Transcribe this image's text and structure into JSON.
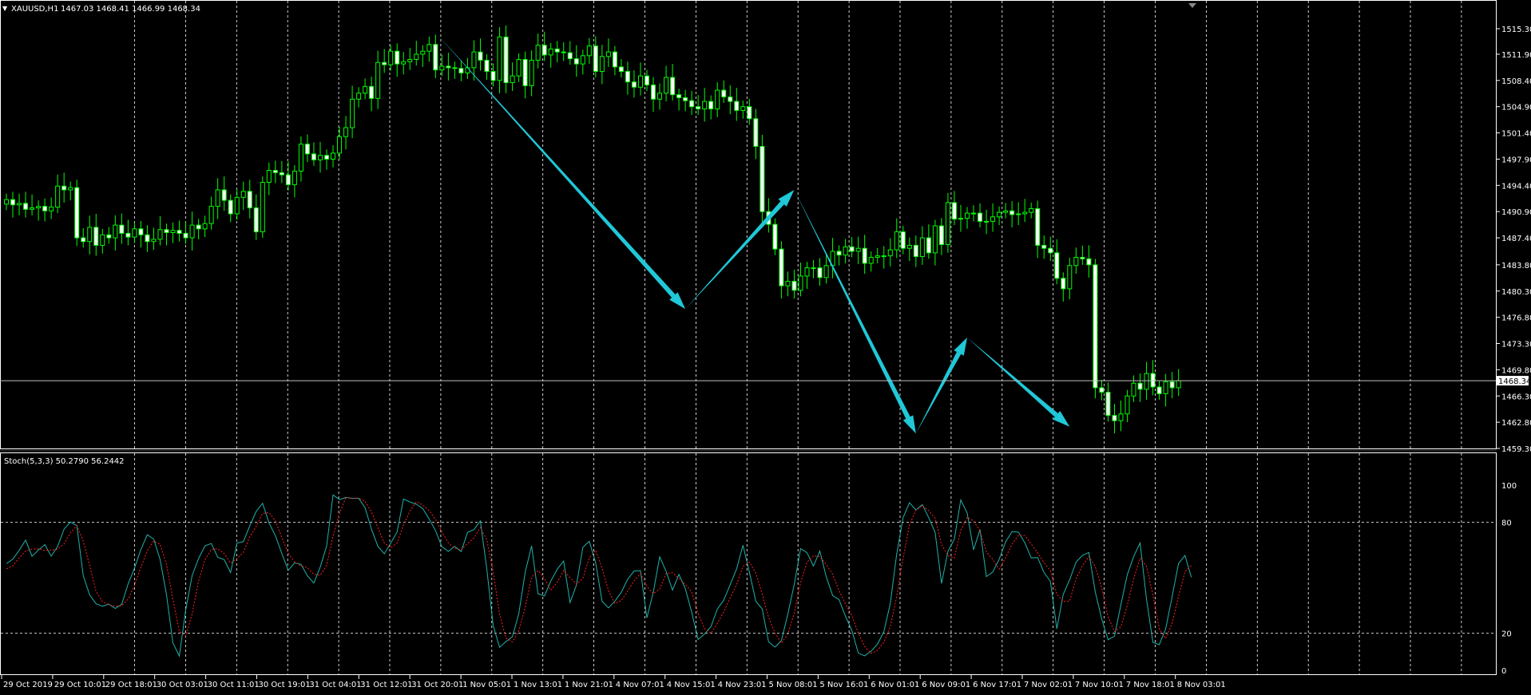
{
  "header": {
    "symbol": "XAUUSD,H1",
    "ohlc": "1467.03 1468.41 1466.99 1468.34",
    "stoch_label": "Stoch(5,3,3) 50.2790 56.2442"
  },
  "colors": {
    "background": "#000000",
    "candle_up_fill": "#000000",
    "candle_down_fill": "#FFFFFF",
    "candle_wick": "#00FF00",
    "grid": "#FFFFFF",
    "price_line": "#C0C0C0",
    "stoch_main": "#20B2AA",
    "stoch_signal": "#FF2020",
    "arrow": "#20C8D8"
  },
  "chart_data": [
    {
      "type": "candlestick",
      "title": "XAUUSD,H1",
      "current_price": 1468.34,
      "y_ticks": [
        1515.3,
        1511.9,
        1508.4,
        1504.9,
        1501.4,
        1497.9,
        1494.4,
        1490.9,
        1487.4,
        1483.8,
        1480.3,
        1476.8,
        1473.3,
        1469.8,
        1466.3,
        1462.8,
        1459.3
      ],
      "y_tick_labels": [
        "1515.30",
        "1511.90",
        "1508.40",
        "1504.90",
        "1501.40",
        "1497.90",
        "1494.40",
        "1490.90",
        "1487.40",
        "1483.80",
        "1480.30",
        "1476.80",
        "1473.30",
        "1469.80",
        "1466.30",
        "1462.80",
        "1459.30"
      ],
      "current_price_label": "1468.34",
      "ylim": [
        1459.3,
        1515.3
      ],
      "x_labels": [
        "29 Oct 2019",
        "29 Oct 10:01",
        "29 Oct 18:01",
        "30 Oct 03:01",
        "30 Oct 11:01",
        "30 Oct 19:01",
        "31 Oct 04:01",
        "31 Oct 12:01",
        "31 Oct 20:01",
        "1 Nov 05:01",
        "1 Nov 13:01",
        "1 Nov 21:01",
        "4 Nov 07:01",
        "4 Nov 15:01",
        "4 Nov 23:01",
        "5 Nov 08:01",
        "5 Nov 16:01",
        "6 Nov 01:01",
        "6 Nov 09:01",
        "6 Nov 17:01",
        "7 Nov 02:01",
        "7 Nov 10:01",
        "7 Nov 18:01",
        "8 Nov 03:01"
      ],
      "closes": [
        1492.5,
        1491.8,
        1492.0,
        1491.2,
        1491.4,
        1491.6,
        1491.0,
        1491.5,
        1494.3,
        1493.8,
        1494.1,
        1487.4,
        1486.9,
        1488.8,
        1486.4,
        1487.8,
        1487.4,
        1489.1,
        1488.0,
        1487.5,
        1488.6,
        1487.8,
        1486.9,
        1487.2,
        1488.5,
        1488.1,
        1488.4,
        1488.0,
        1487.4,
        1489.1,
        1488.6,
        1489.3,
        1491.6,
        1493.8,
        1492.4,
        1490.6,
        1492.8,
        1493.6,
        1491.4,
        1488.2,
        1494.8,
        1496.4,
        1496.1,
        1495.8,
        1494.5,
        1496.3,
        1499.9,
        1498.6,
        1497.8,
        1498.4,
        1497.9,
        1498.7,
        1500.9,
        1502.1,
        1505.9,
        1506.7,
        1507.6,
        1506.0,
        1510.8,
        1510.5,
        1512.3,
        1510.6,
        1510.9,
        1511.2,
        1511.9,
        1512.3,
        1513.2,
        1509.8,
        1510.3,
        1510.1,
        1510.0,
        1509.4,
        1510.1,
        1512.2,
        1511.1,
        1509.6,
        1508.4,
        1514.2,
        1508.1,
        1509.0,
        1511.2,
        1507.7,
        1511.1,
        1513.1,
        1511.8,
        1512.6,
        1512.2,
        1512.1,
        1511.3,
        1510.6,
        1511.7,
        1513.0,
        1509.6,
        1511.6,
        1512.2,
        1510.2,
        1509.6,
        1508.2,
        1507.5,
        1509.0,
        1507.8,
        1505.9,
        1506.7,
        1508.8,
        1506.5,
        1506.1,
        1505.7,
        1504.9,
        1504.6,
        1505.6,
        1504.6,
        1507.1,
        1506.2,
        1505.6,
        1504.4,
        1504.9,
        1503.3,
        1499.6,
        1490.9,
        1489.2,
        1485.9,
        1481.0,
        1481.6,
        1480.4,
        1482.3,
        1483.4,
        1483.4,
        1482.1,
        1483.7,
        1485.6,
        1485.1,
        1486.2,
        1485.6,
        1486.0,
        1484.0,
        1484.8,
        1485.0,
        1485.0,
        1485.8,
        1488.2,
        1486.0,
        1486.4,
        1484.9,
        1487.4,
        1485.4,
        1489.0,
        1486.5,
        1492.1,
        1489.9,
        1490.0,
        1490.7,
        1490.7,
        1489.6,
        1489.6,
        1490.2,
        1490.8,
        1491.0,
        1490.5,
        1490.6,
        1490.8,
        1491.3,
        1486.4,
        1486.0,
        1485.4,
        1482.0,
        1480.6,
        1483.7,
        1484.8,
        1484.6,
        1483.8,
        1467.4,
        1466.8,
        1463.7,
        1463.0,
        1463.9,
        1466.3,
        1468.0,
        1467.2,
        1469.3,
        1467.5,
        1466.6,
        1468.2,
        1467.4,
        1468.34
      ],
      "forecast_path": [
        {
          "candle": 67,
          "price": 1514.8
        },
        {
          "candle": 106,
          "price": 1477.9
        },
        {
          "candle": 123,
          "price": 1493.8
        },
        {
          "candle": 142,
          "price": 1461.3
        },
        {
          "candle": 150,
          "price": 1474.1
        },
        {
          "candle": 166,
          "price": 1462.2
        }
      ]
    },
    {
      "type": "line",
      "title": "Stoch(5,3,3) 50.2790 56.2442",
      "ylim": [
        0,
        100
      ],
      "y_ticks": [
        0,
        20,
        80,
        100
      ],
      "y_tick_labels": [
        "0",
        "20",
        "80",
        "100"
      ],
      "levels": [
        20,
        80
      ],
      "series": [
        {
          "name": "Main",
          "values": [
            57.6,
            60.0,
            64.8,
            70.3,
            61.6,
            64.9,
            67.9,
            61.6,
            66.9,
            76.2,
            80.1,
            78.1,
            51.1,
            40.7,
            35.9,
            34.6,
            35.7,
            33.4,
            35.6,
            46.6,
            55.2,
            65.3,
            73.2,
            70.9,
            59.8,
            40.8,
            14.7,
            7.7,
            32.7,
            51.2,
            60.3,
            67.2,
            68.5,
            61.0,
            59.8,
            52.8,
            68.7,
            69.5,
            78.0,
            85.8,
            90.2,
            79.6,
            72.7,
            63.1,
            54.0,
            58.0,
            57.2,
            51.0,
            47.1,
            55.8,
            67.1,
            94.7,
            92.2,
            93.3,
            92.9,
            92.9,
            87.8,
            76.2,
            67.0,
            62.9,
            68.7,
            74.7,
            92.5,
            90.9,
            89.7,
            87.4,
            81.8,
            75.4,
            66.7,
            64.2,
            66.9,
            64.1,
            74.5,
            76.0,
            80.7,
            54.8,
            24.2,
            12.4,
            15.5,
            18.1,
            30.6,
            53.0,
            67.2,
            41.4,
            40.1,
            48.2,
            54.6,
            59.0,
            36.6,
            46.0,
            66.4,
            69.7,
            58.2,
            37.3,
            33.7,
            37.3,
            42.1,
            49.2,
            53.6,
            53.8,
            28.3,
            42.2,
            61.3,
            53.4,
            43.3,
            51.8,
            44.1,
            31.3,
            16.6,
            19.6,
            23.6,
            33.1,
            37.9,
            46.2,
            54.7,
            67.5,
            53.0,
            37.3,
            33.2,
            15.3,
            12.5,
            16.0,
            30.3,
            46.3,
            65.7,
            63.5,
            56.3,
            64.4,
            50.5,
            40.4,
            38.1,
            29.2,
            21.5,
            9.3,
            7.8,
            10.3,
            14.1,
            20.9,
            36.1,
            62.8,
            82.5,
            90.5,
            86.6,
            89.5,
            82.4,
            74.5,
            46.9,
            64.2,
            70.8,
            92.0,
            84.9,
            65.1,
            76.0,
            50.6,
            53.1,
            60.0,
            69.3,
            74.9,
            74.6,
            68.9,
            60.7,
            60.9,
            52.8,
            48.0,
            22.4,
            41.0,
            48.9,
            58.4,
            62.1,
            63.6,
            42.4,
            27.8,
            16.5,
            18.4,
            35.4,
            51.6,
            61.5,
            68.8,
            38.4,
            15.1,
            13.8,
            22.5,
            39.8,
            57.7,
            62.0,
            50.2
          ]
        },
        {
          "name": "Signal",
          "values": [
            54.8,
            56.4,
            60.8,
            64.4,
            65.5,
            65.6,
            64.8,
            64.8,
            65.5,
            68.2,
            74.4,
            78.1,
            69.8,
            56.6,
            42.6,
            37.1,
            35.4,
            34.6,
            34.9,
            38.5,
            45.8,
            55.7,
            64.6,
            69.8,
            68.0,
            57.2,
            38.4,
            21.1,
            18.4,
            30.5,
            48.1,
            59.6,
            65.3,
            65.6,
            63.1,
            57.9,
            60.4,
            63.7,
            72.1,
            77.8,
            84.7,
            85.2,
            80.8,
            71.8,
            63.3,
            58.4,
            56.4,
            55.4,
            51.8,
            51.3,
            56.7,
            72.5,
            84.7,
            93.4,
            92.8,
            93.0,
            91.2,
            85.6,
            77.0,
            68.7,
            66.2,
            68.8,
            78.6,
            86.0,
            91.0,
            89.3,
            86.3,
            81.5,
            74.6,
            68.8,
            65.9,
            65.1,
            68.5,
            71.5,
            77.1,
            70.5,
            53.2,
            30.5,
            17.4,
            15.3,
            21.4,
            33.9,
            50.3,
            53.9,
            49.6,
            43.2,
            47.6,
            53.9,
            50.1,
            46.5,
            49.7,
            60.7,
            64.8,
            55.1,
            43.1,
            36.1,
            37.7,
            42.9,
            48.3,
            52.2,
            45.2,
            41.4,
            43.9,
            52.3,
            52.7,
            49.5,
            46.4,
            42.4,
            30.7,
            22.5,
            19.9,
            25.4,
            31.5,
            39.1,
            46.3,
            56.1,
            58.4,
            52.6,
            41.2,
            28.6,
            20.3,
            14.6,
            19.6,
            30.9,
            47.4,
            58.5,
            61.8,
            61.4,
            57.1,
            51.8,
            43.0,
            35.9,
            29.6,
            20.0,
            12.9,
            9.1,
            10.7,
            15.1,
            23.7,
            39.9,
            60.5,
            78.6,
            86.5,
            88.9,
            86.2,
            82.1,
            67.9,
            61.9,
            60.6,
            75.6,
            82.6,
            80.7,
            75.3,
            63.9,
            59.9,
            54.6,
            60.8,
            68.1,
            72.9,
            72.8,
            68.1,
            63.5,
            58.1,
            53.9,
            41.1,
            37.1,
            37.4,
            49.4,
            56.5,
            61.4,
            56.0,
            44.6,
            28.9,
            20.9,
            23.4,
            35.1,
            49.5,
            60.6,
            56.2,
            40.8,
            22.4,
            17.1,
            25.4,
            40.0,
            53.2,
            56.6
          ]
        }
      ]
    }
  ]
}
